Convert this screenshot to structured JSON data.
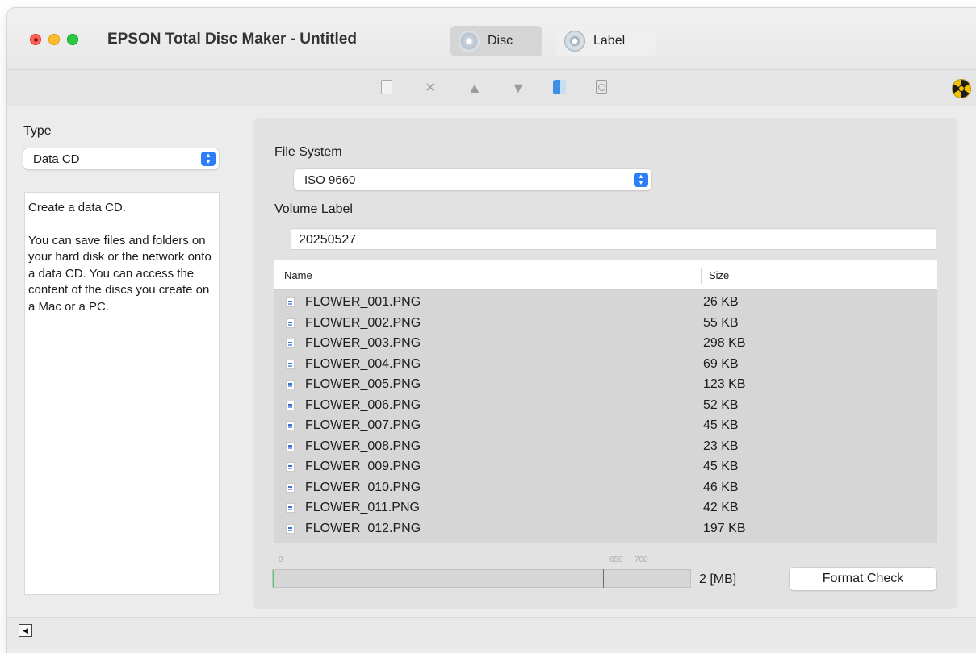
{
  "window": {
    "title": "EPSON Total Disc Maker - Untitled",
    "tabs": [
      {
        "label": "Disc",
        "icon": "disc-icon",
        "selected": true
      },
      {
        "label": "Label",
        "icon": "label-icon",
        "selected": false
      }
    ]
  },
  "toolbar": {
    "icons": [
      "new-document-icon",
      "delete-icon",
      "move-up-icon",
      "move-down-icon",
      "finder-icon",
      "disc-burn-icon",
      "hazard-icon"
    ],
    "delete_glyph": "×",
    "up_glyph": "▲",
    "down_glyph": "▼"
  },
  "sidebar": {
    "type_label": "Type",
    "type_value": "Data CD",
    "description_title": "Create a data CD.",
    "description_body": "You can save files and folders on your hard disk or the network onto a data CD. You can access the content of the discs you create on a Mac or a PC."
  },
  "main": {
    "file_system_label": "File System",
    "file_system_value": "ISO 9660",
    "volume_label_label": "Volume Label",
    "volume_label_value": "20250527",
    "columns": {
      "name": "Name",
      "size": "Size"
    },
    "files": [
      {
        "name": "FLOWER_001.PNG",
        "size": "26 KB"
      },
      {
        "name": "FLOWER_002.PNG",
        "size": "55 KB"
      },
      {
        "name": "FLOWER_003.PNG",
        "size": "298 KB"
      },
      {
        "name": "FLOWER_004.PNG",
        "size": "69 KB"
      },
      {
        "name": "FLOWER_005.PNG",
        "size": "123 KB"
      },
      {
        "name": "FLOWER_006.PNG",
        "size": "52 KB"
      },
      {
        "name": "FLOWER_007.PNG",
        "size": "45 KB"
      },
      {
        "name": "FLOWER_008.PNG",
        "size": "23 KB"
      },
      {
        "name": "FLOWER_009.PNG",
        "size": "45 KB"
      },
      {
        "name": "FLOWER_010.PNG",
        "size": "46 KB"
      },
      {
        "name": "FLOWER_011.PNG",
        "size": "42 KB"
      },
      {
        "name": "FLOWER_012.PNG",
        "size": "197 KB"
      }
    ]
  },
  "capacity": {
    "ticks": [
      "0",
      "650",
      "700"
    ],
    "max_mb": 825,
    "used_mb": 2,
    "used_label": "2 [MB]",
    "fill_color": "#4fcf5f"
  },
  "format_check_label": "Format Check",
  "scroll_left_glyph": "◀"
}
